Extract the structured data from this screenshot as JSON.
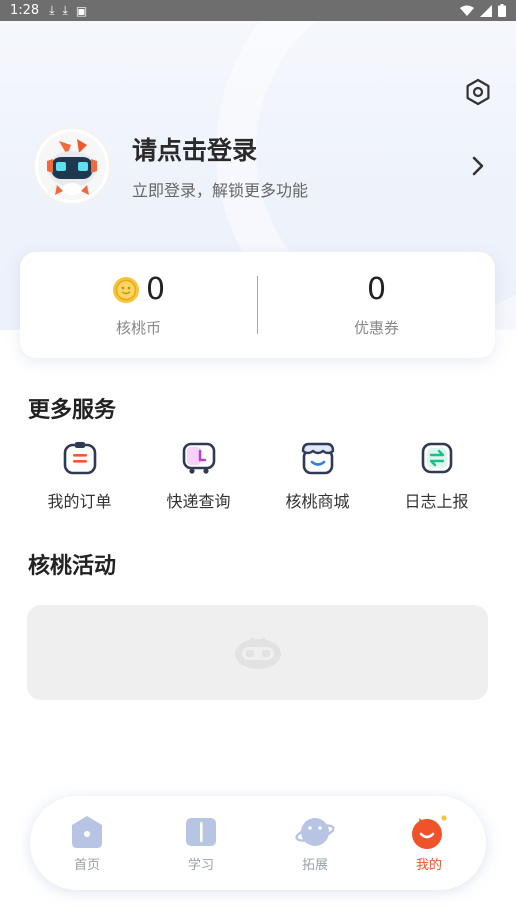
{
  "status_bar": {
    "time": "1:28"
  },
  "profile": {
    "title": "请点击登录",
    "subtitle": "立即登录，解锁更多功能"
  },
  "stats": {
    "coins": {
      "value": "0",
      "label": "核桃币"
    },
    "coupons": {
      "value": "0",
      "label": "优惠券"
    }
  },
  "services": {
    "title": "更多服务",
    "items": [
      {
        "label": "我的订单",
        "icon": "order-icon"
      },
      {
        "label": "快递查询",
        "icon": "delivery-icon"
      },
      {
        "label": "核桃商城",
        "icon": "shop-icon"
      },
      {
        "label": "日志上报",
        "icon": "log-upload-icon"
      }
    ]
  },
  "activities": {
    "title": "核桃活动"
  },
  "tabbar": {
    "items": [
      {
        "label": "首页",
        "icon": "home-icon"
      },
      {
        "label": "学习",
        "icon": "book-icon"
      },
      {
        "label": "拓展",
        "icon": "planet-icon"
      },
      {
        "label": "我的",
        "icon": "profile-icon"
      }
    ],
    "active_index": 3
  },
  "colors": {
    "accent": "#f0532a",
    "inactive": "#9aa0ad",
    "card_bg": "#ffffff"
  }
}
